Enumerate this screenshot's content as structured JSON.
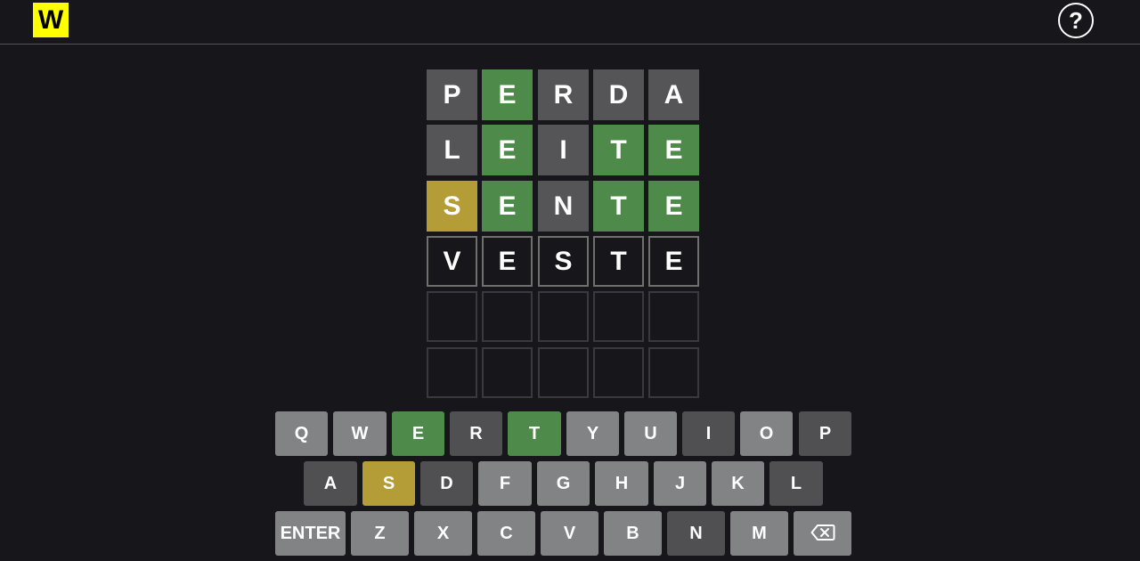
{
  "header": {
    "logo_text": "W",
    "help_label": "?"
  },
  "board": {
    "rows": [
      [
        {
          "letter": "P",
          "state": "absent"
        },
        {
          "letter": "E",
          "state": "correct"
        },
        {
          "letter": "R",
          "state": "absent"
        },
        {
          "letter": "D",
          "state": "absent"
        },
        {
          "letter": "A",
          "state": "absent"
        }
      ],
      [
        {
          "letter": "L",
          "state": "absent"
        },
        {
          "letter": "E",
          "state": "correct"
        },
        {
          "letter": "I",
          "state": "absent"
        },
        {
          "letter": "T",
          "state": "correct"
        },
        {
          "letter": "E",
          "state": "correct"
        }
      ],
      [
        {
          "letter": "S",
          "state": "present"
        },
        {
          "letter": "E",
          "state": "correct"
        },
        {
          "letter": "N",
          "state": "absent"
        },
        {
          "letter": "T",
          "state": "correct"
        },
        {
          "letter": "E",
          "state": "correct"
        }
      ],
      [
        {
          "letter": "V",
          "state": "typed"
        },
        {
          "letter": "E",
          "state": "typed"
        },
        {
          "letter": "S",
          "state": "typed"
        },
        {
          "letter": "T",
          "state": "typed"
        },
        {
          "letter": "E",
          "state": "typed"
        }
      ],
      [
        {
          "letter": "",
          "state": "empty"
        },
        {
          "letter": "",
          "state": "empty"
        },
        {
          "letter": "",
          "state": "empty"
        },
        {
          "letter": "",
          "state": "empty"
        },
        {
          "letter": "",
          "state": "empty"
        }
      ],
      [
        {
          "letter": "",
          "state": "empty"
        },
        {
          "letter": "",
          "state": "empty"
        },
        {
          "letter": "",
          "state": "empty"
        },
        {
          "letter": "",
          "state": "empty"
        },
        {
          "letter": "",
          "state": "empty"
        }
      ]
    ]
  },
  "keyboard": {
    "rows": [
      [
        {
          "label": "Q",
          "state": "unused"
        },
        {
          "label": "W",
          "state": "unused"
        },
        {
          "label": "E",
          "state": "correct"
        },
        {
          "label": "R",
          "state": "absent"
        },
        {
          "label": "T",
          "state": "correct"
        },
        {
          "label": "Y",
          "state": "unused"
        },
        {
          "label": "U",
          "state": "unused"
        },
        {
          "label": "I",
          "state": "absent"
        },
        {
          "label": "O",
          "state": "unused"
        },
        {
          "label": "P",
          "state": "absent"
        }
      ],
      [
        {
          "label": "A",
          "state": "absent"
        },
        {
          "label": "S",
          "state": "present"
        },
        {
          "label": "D",
          "state": "absent"
        },
        {
          "label": "F",
          "state": "unused"
        },
        {
          "label": "G",
          "state": "unused"
        },
        {
          "label": "H",
          "state": "unused"
        },
        {
          "label": "J",
          "state": "unused"
        },
        {
          "label": "K",
          "state": "unused"
        },
        {
          "label": "L",
          "state": "absent"
        }
      ],
      [
        {
          "label": "ENTER",
          "state": "unused"
        },
        {
          "label": "Z",
          "state": "unused"
        },
        {
          "label": "X",
          "state": "unused"
        },
        {
          "label": "C",
          "state": "unused"
        },
        {
          "label": "V",
          "state": "unused"
        },
        {
          "label": "B",
          "state": "unused"
        },
        {
          "label": "N",
          "state": "absent"
        },
        {
          "label": "M",
          "state": "unused"
        },
        {
          "label": "",
          "icon": "backspace-icon",
          "state": "unused"
        }
      ]
    ]
  },
  "colors": {
    "correct": "#4e8b4a",
    "present": "#b49c36",
    "absent": "#555557",
    "key_unused": "#818384",
    "logo_bg": "#ffff00",
    "background": "#16161b"
  }
}
